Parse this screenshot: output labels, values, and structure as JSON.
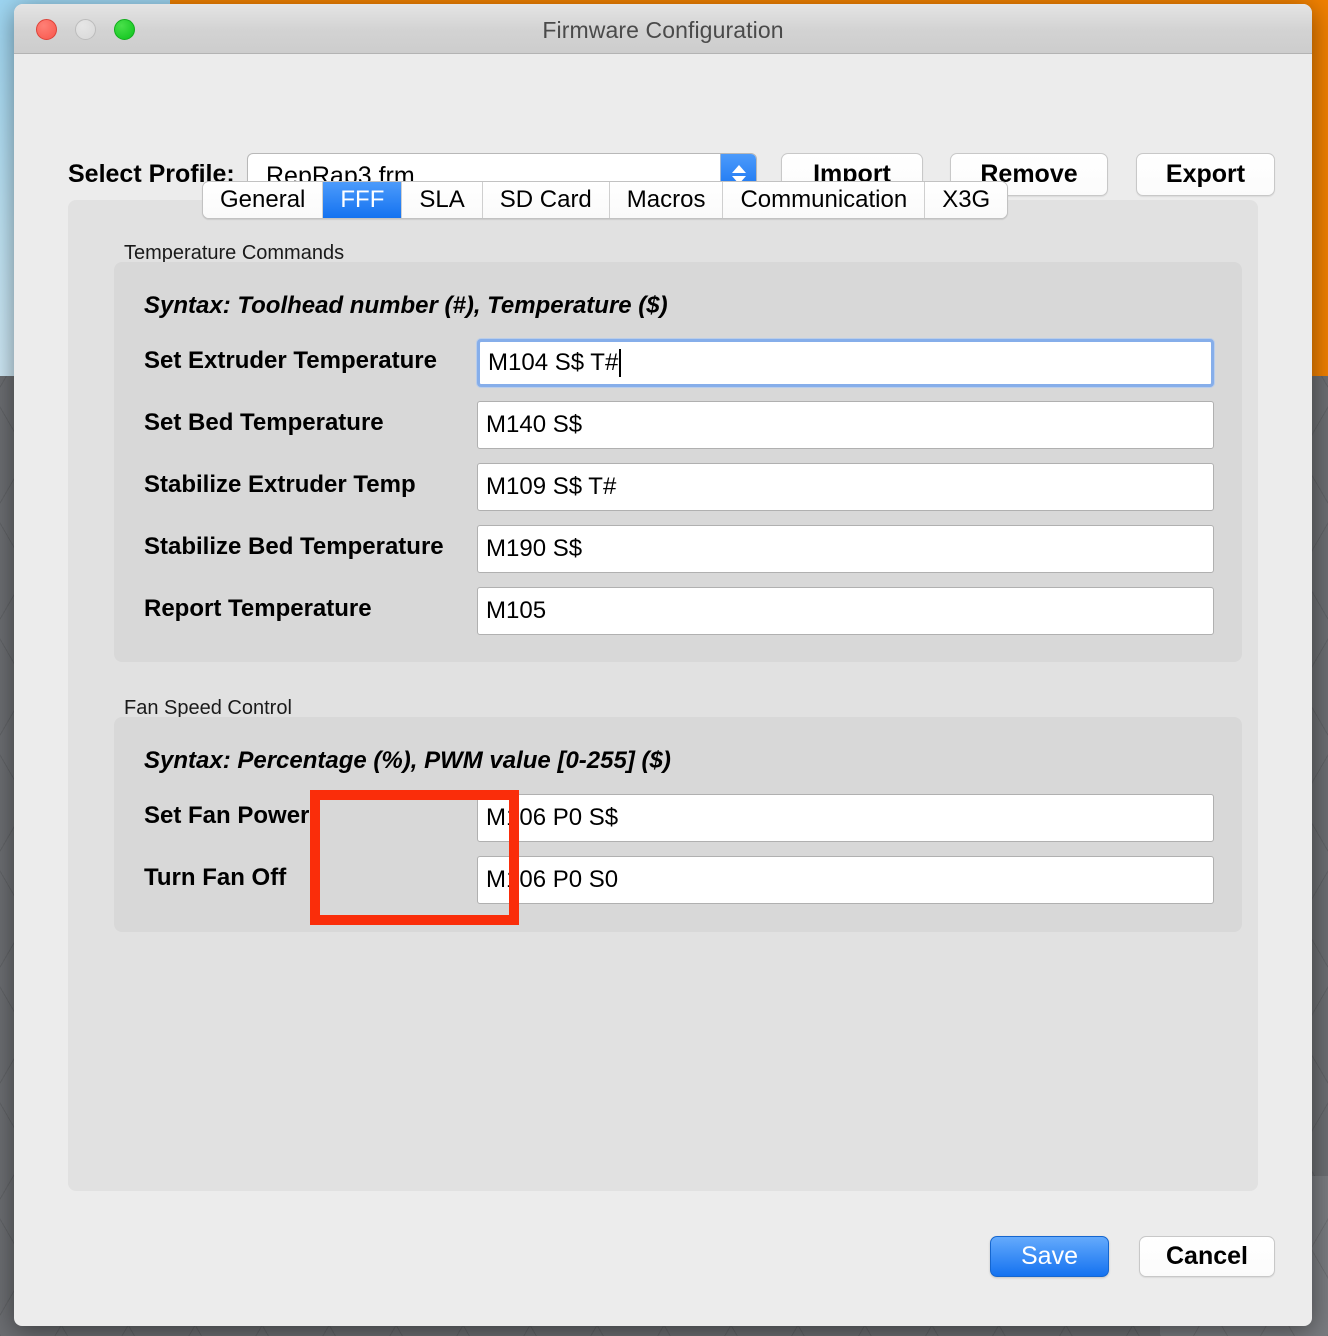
{
  "window": {
    "title": "Firmware Configuration",
    "traffic_lights": [
      "close-button",
      "minimize-button",
      "zoom-button"
    ]
  },
  "profile": {
    "label": "Select Profile:",
    "value": "RepRap3.frm",
    "buttons": [
      {
        "id": "import",
        "label": "Import"
      },
      {
        "id": "remove",
        "label": "Remove"
      },
      {
        "id": "export",
        "label": "Export"
      }
    ]
  },
  "tabs": [
    {
      "label": "General",
      "active": false
    },
    {
      "label": "FFF",
      "active": true
    },
    {
      "label": "SLA",
      "active": false
    },
    {
      "label": "SD Card",
      "active": false
    },
    {
      "label": "Macros",
      "active": false
    },
    {
      "label": "Communication",
      "active": false
    },
    {
      "label": "X3G",
      "active": false
    }
  ],
  "groups": [
    {
      "title": "Temperature Commands",
      "syntax": "Syntax: Toolhead number (#), Temperature ($)",
      "rows": [
        {
          "label": "Set Extruder Temperature",
          "value": "M104 S$ T#",
          "focused": true
        },
        {
          "label": "Set Bed Temperature",
          "value": "M140 S$",
          "focused": false
        },
        {
          "label": "Stabilize Extruder Temp",
          "value": "M109 S$ T#",
          "focused": false
        },
        {
          "label": "Stabilize Bed Temperature",
          "value": "M190 S$",
          "focused": false
        },
        {
          "label": "Report Temperature",
          "value": "M105",
          "focused": false
        }
      ]
    },
    {
      "title": "Fan Speed Control",
      "syntax": "Syntax: Percentage (%), PWM value [0-255] ($)",
      "rows": [
        {
          "label": "Set Fan Power",
          "value": "M106 P0 S$",
          "focused": false
        },
        {
          "label": "Turn Fan Off",
          "value": "M106 P0 S0",
          "focused": false
        }
      ]
    }
  ],
  "footer": {
    "save_label": "Save",
    "cancel_label": "Cancel"
  },
  "annotation": {
    "color": "#fa2d0a",
    "shape": "rectangle-outline"
  },
  "colors": {
    "accent_blue": "#1472f0",
    "window_bg": "#ececec",
    "panel_bg": "#e1e1e1",
    "groupbox_bg": "#d8d8d8",
    "desktop_orange": "#f08000",
    "highlight_red": "#fa2d0a"
  }
}
